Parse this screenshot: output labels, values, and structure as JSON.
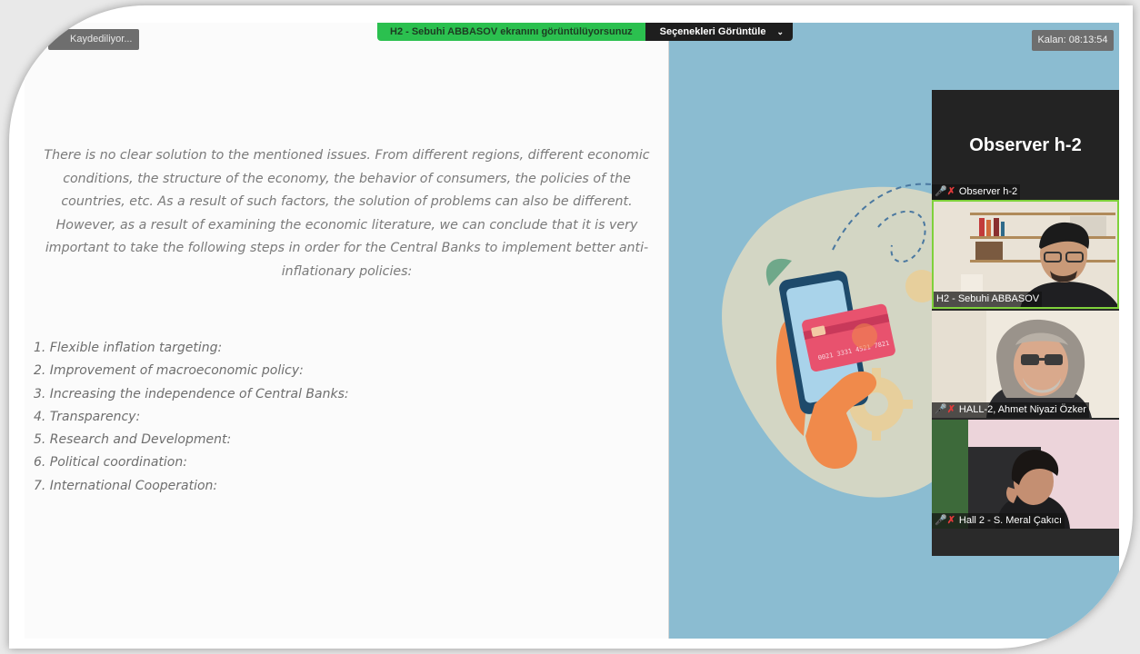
{
  "toolbar": {
    "recording_label": "Kaydediliyor...",
    "share_banner": "H2 - Sebuhi ABBASOV ekranını görüntülüyorsunuz",
    "view_options": "Seçenekleri Görüntüle",
    "timer": "Kalan: 08:13:54"
  },
  "slide": {
    "paragraph": "There is no clear solution to the mentioned issues. From different regions, different economic conditions, the structure of the economy, the behavior of consumers, the policies of the countries, etc. As a result of such factors, the solution of problems can also be different. However, as a result of examining the economic literature, we can conclude that it is very important to take the following steps in order for the Central Banks to implement better anti-inflationary policies:",
    "steps": [
      "1. Flexible inflation targeting:",
      "2. Improvement of macroeconomic policy:",
      "3. Increasing the independence of Central Banks:",
      "4. Transparency:",
      "5. Research and Development:",
      "6. Political coordination:",
      "7. International Cooperation:"
    ]
  },
  "card_number_text": "0021 3331 4521 7821",
  "participants": {
    "observer_display": "Observer h-2",
    "tiles": [
      {
        "name": "Observer h-2",
        "muted": true
      },
      {
        "name": "H2 - Sebuhi ABBASOV",
        "muted": false
      },
      {
        "name": "HALL-2, Ahmet Niyazi Özker",
        "muted": true
      },
      {
        "name": "Hall 2 - S. Meral Çakıcı",
        "muted": true
      }
    ]
  },
  "colors": {
    "share_green": "#2bc04f",
    "illustration_bg": "#8bbcd1",
    "active_speaker": "#7fd13b",
    "muted_red": "#e23b3b"
  },
  "icons": [
    "mic-muted-icon",
    "chevron-down-icon"
  ]
}
